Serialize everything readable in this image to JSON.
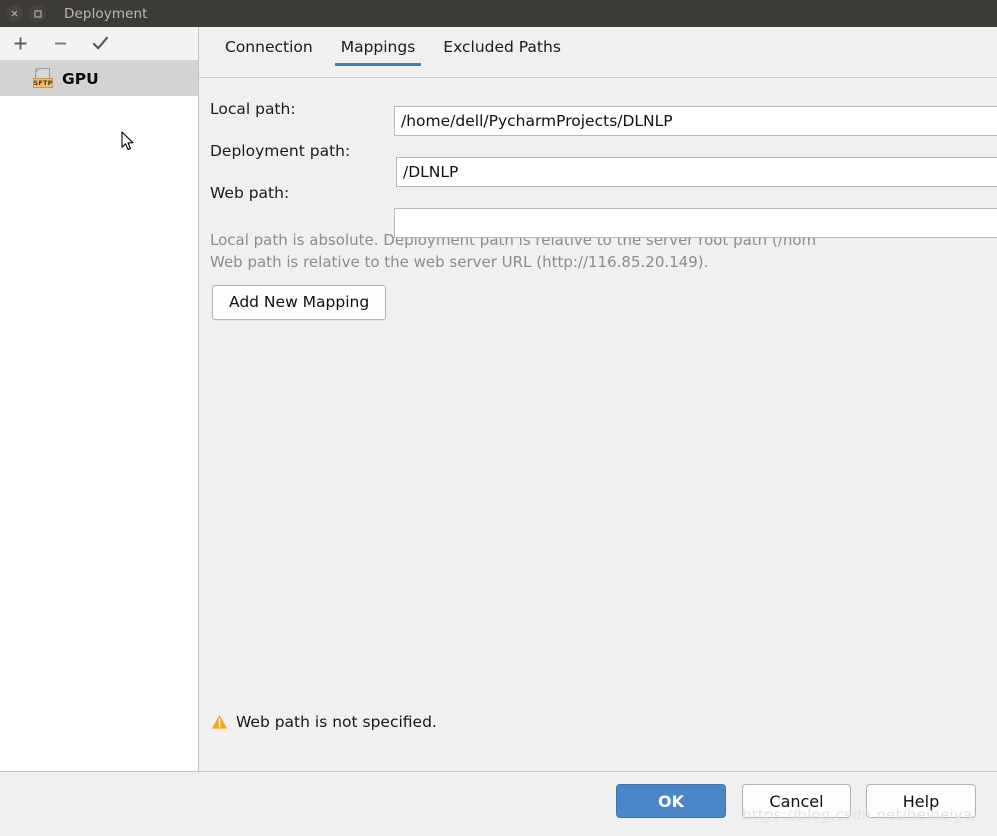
{
  "window": {
    "title": "Deployment",
    "close_icon": "close-icon",
    "maximize_icon": "maximize-icon"
  },
  "sidebar": {
    "toolbar": [
      {
        "name": "add-server-button",
        "icon": "plus-icon",
        "label": "+"
      },
      {
        "name": "remove-server-button",
        "icon": "minus-icon",
        "label": "−"
      },
      {
        "name": "set-default-server-button",
        "icon": "check-icon",
        "label": "✓"
      }
    ],
    "items": [
      {
        "label": "GPU",
        "icon": "sftp-icon",
        "icon_badge": "SFTP",
        "selected": true
      }
    ]
  },
  "tabs": [
    {
      "label": "Connection",
      "active": false
    },
    {
      "label": "Mappings",
      "active": true
    },
    {
      "label": "Excluded Paths",
      "active": false
    }
  ],
  "form": {
    "local_path": {
      "label": "Local path:",
      "value": "/home/dell/PycharmProjects/DLNLP",
      "placeholder": ""
    },
    "deployment_path": {
      "label": "Deployment path:",
      "value": "/DLNLP",
      "placeholder": ""
    },
    "web_path": {
      "label": "Web path:",
      "value": "",
      "placeholder": ""
    }
  },
  "description": {
    "line1": "Local path is absolute. Deployment path is relative to the server root path (/hom",
    "line2": "Web path is relative to the web server URL (http://116.85.20.149)."
  },
  "actions": {
    "add_new_mapping": "Add New Mapping"
  },
  "status": {
    "warning_icon": "warning-triangle-icon",
    "warning_text": "Web path is not specified."
  },
  "footer": {
    "ok": "OK",
    "cancel": "Cancel",
    "help": "Help",
    "watermark": "https://blog.csdn.net/heiheiya"
  },
  "colors": {
    "titlebar": "#3c3b37",
    "accent": "#3d7ebd",
    "ok_button": "#4a86c8",
    "warning": "#f0a91e",
    "selection": "#d3d3d3"
  }
}
